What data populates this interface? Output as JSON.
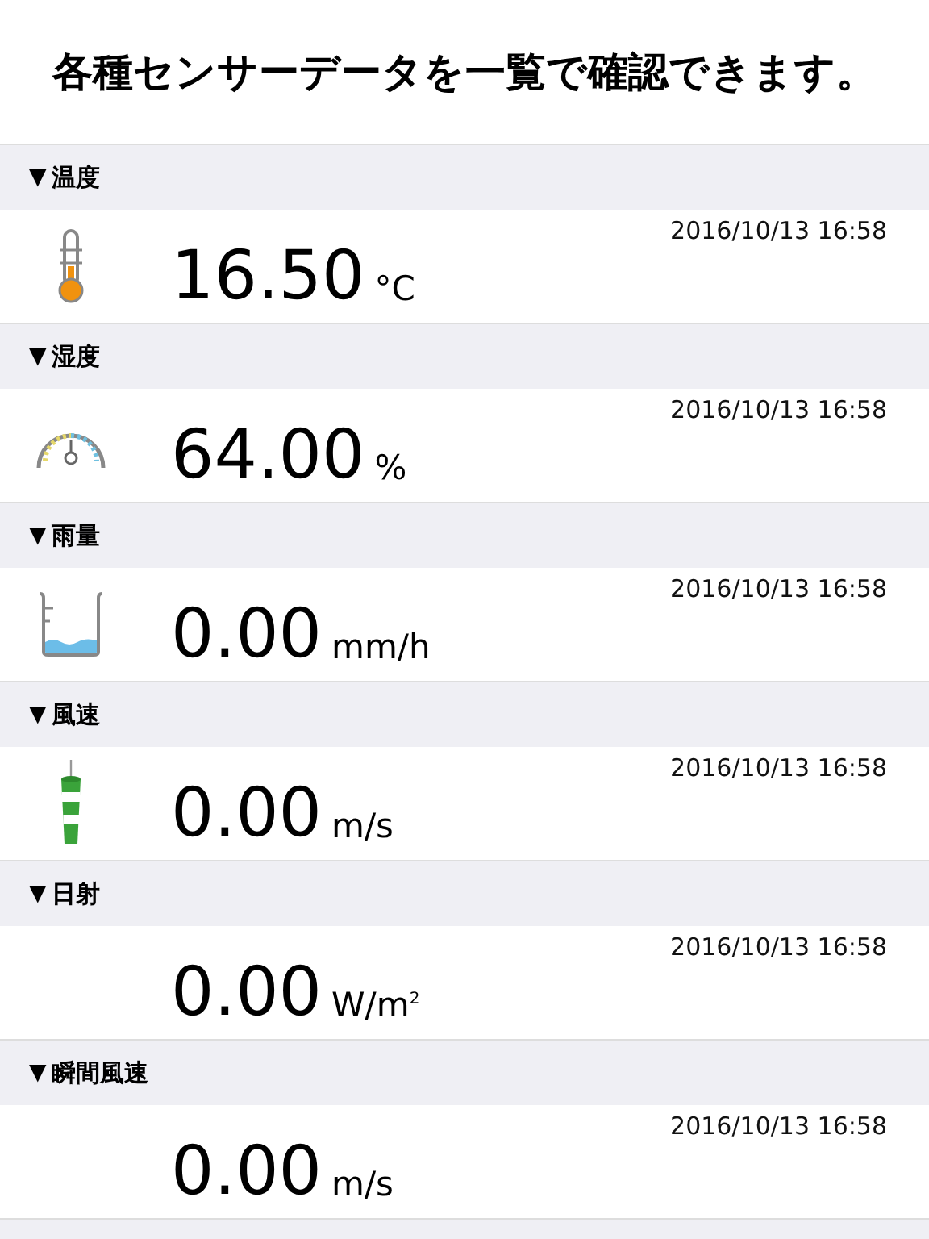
{
  "title": "各種センサーデータを一覧で確認できます。",
  "sections": [
    {
      "toggle": "▼",
      "label": "温度",
      "kind": "thermometer",
      "value": "16.50",
      "unit": "°C",
      "time": "2016/10/13 16:58"
    },
    {
      "toggle": "▼",
      "label": "湿度",
      "kind": "gauge",
      "value": "64.00",
      "unit": "%",
      "time": "2016/10/13 16:58"
    },
    {
      "toggle": "▼",
      "label": "雨量",
      "kind": "beaker",
      "value": "0.00",
      "unit": "mm/h",
      "time": "2016/10/13 16:58"
    },
    {
      "toggle": "▼",
      "label": "風速",
      "kind": "windsock",
      "value": "0.00",
      "unit": "m/s",
      "time": "2016/10/13 16:58"
    },
    {
      "toggle": "▼",
      "label": "日射",
      "value": "0.00",
      "unit": "W/m$^{2}$",
      "time": "2016/10/13 16:58"
    },
    {
      "toggle": "▼",
      "label": "瞬間風速",
      "value": "0.00",
      "unit": "m/s",
      "time": "2016/10/13 16:58"
    }
  ]
}
